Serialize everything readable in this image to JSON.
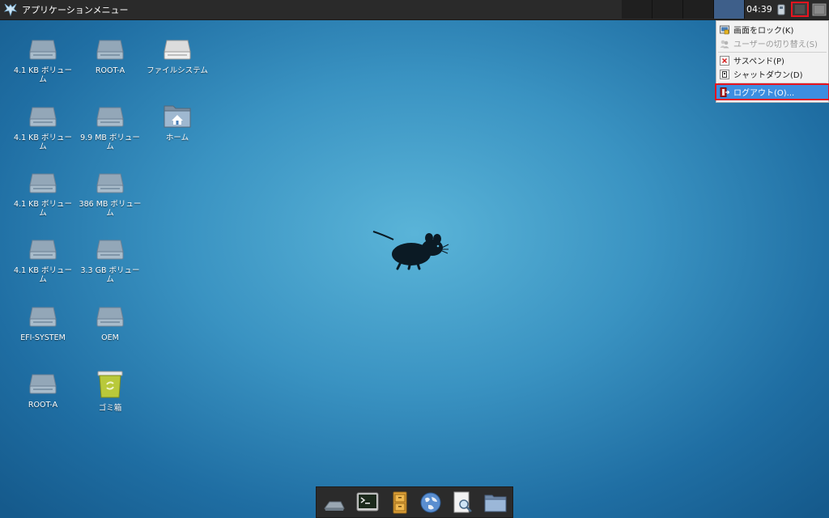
{
  "topbar": {
    "app_menu_label": "アプリケーションメニュー",
    "clock": "04:39"
  },
  "user_menu": {
    "items": [
      {
        "label": "画面をロック(K)",
        "enabled": true,
        "icon": "lock-screen-icon"
      },
      {
        "label": "ユーザーの切り替え(S)",
        "enabled": false,
        "icon": "switch-user-icon"
      },
      {
        "label": "サスペンド(P)",
        "enabled": true,
        "icon": "suspend-icon"
      },
      {
        "label": "シャットダウン(D)",
        "enabled": true,
        "icon": "shutdown-icon"
      },
      {
        "label": "ログアウト(O)...",
        "enabled": true,
        "icon": "logout-icon",
        "highlighted": true
      }
    ]
  },
  "desktop": {
    "icons": [
      {
        "label": "4.1 KB ボリューム",
        "icon": "drive-icon"
      },
      {
        "label": "ROOT-A",
        "icon": "drive-icon"
      },
      {
        "label": "ファイルシステム",
        "icon": "filesystem-icon"
      },
      {
        "label": "4.1 KB ボリューム",
        "icon": "drive-icon"
      },
      {
        "label": "9.9 MB ボリューム",
        "icon": "drive-icon"
      },
      {
        "label": "ホーム",
        "icon": "home-folder-icon"
      },
      {
        "label": "4.1 KB ボリューム",
        "icon": "drive-icon"
      },
      {
        "label": "386 MB ボリューム",
        "icon": "drive-icon"
      },
      {
        "label": "4.1 KB ボリューム",
        "icon": "drive-icon"
      },
      {
        "label": "3.3 GB ボリューム",
        "icon": "drive-icon"
      },
      {
        "label": "EFI-SYSTEM",
        "icon": "drive-icon"
      },
      {
        "label": "OEM",
        "icon": "drive-icon"
      },
      {
        "label": "ROOT-A",
        "icon": "drive-icon"
      },
      {
        "label": "ゴミ箱",
        "icon": "trash-icon"
      }
    ]
  },
  "dock": {
    "items": [
      "show-desktop-icon",
      "terminal-icon",
      "file-cabinet-icon",
      "web-browser-icon",
      "app-finder-icon",
      "folder-icon"
    ]
  },
  "colors": {
    "accent": "#3d8ee0",
    "highlight_border": "#e8141f"
  }
}
